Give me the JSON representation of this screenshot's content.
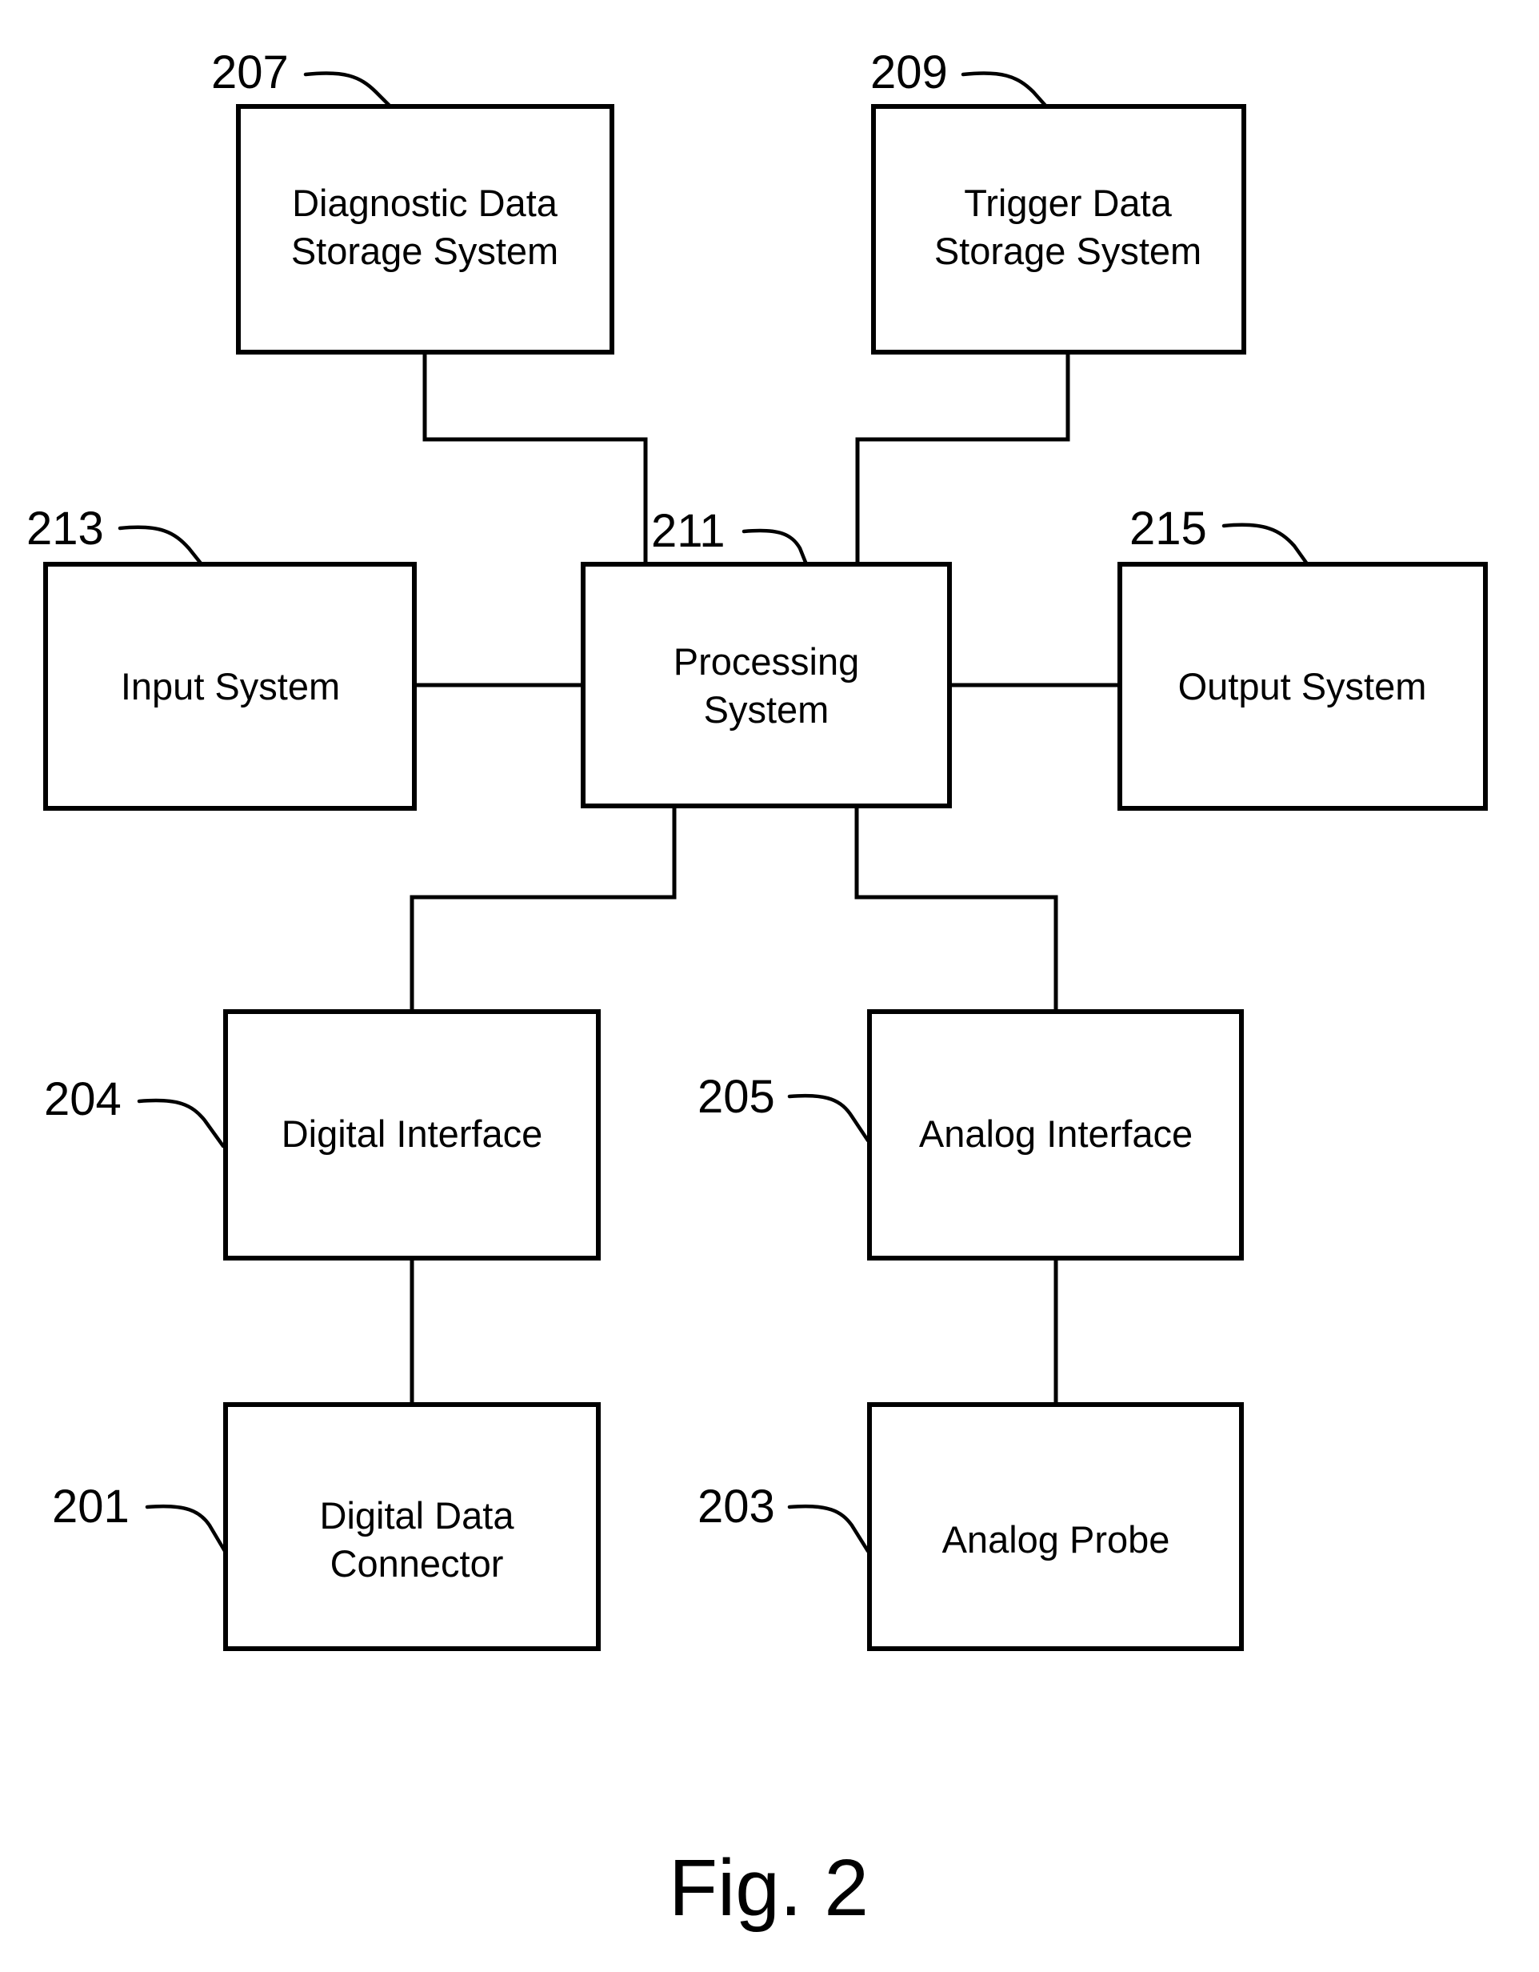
{
  "figure": {
    "caption": "Fig. 2",
    "nodes": [
      {
        "id": "207",
        "ref": "207",
        "lines": [
          "Diagnostic Data",
          "Storage System"
        ]
      },
      {
        "id": "209",
        "ref": "209",
        "lines": [
          "Trigger Data",
          "Storage System"
        ]
      },
      {
        "id": "213",
        "ref": "213",
        "lines": [
          "Input System"
        ]
      },
      {
        "id": "211",
        "ref": "211",
        "lines": [
          "Processing",
          "System"
        ]
      },
      {
        "id": "215",
        "ref": "215",
        "lines": [
          "Output System"
        ]
      },
      {
        "id": "204",
        "ref": "204",
        "lines": [
          "Digital Interface"
        ]
      },
      {
        "id": "205",
        "ref": "205",
        "lines": [
          "Analog Interface"
        ]
      },
      {
        "id": "201",
        "ref": "201",
        "lines": [
          "Digital Data",
          "Connector"
        ]
      },
      {
        "id": "203",
        "ref": "203",
        "lines": [
          "Analog Probe"
        ]
      }
    ],
    "edges": [
      {
        "from": "207",
        "to": "211"
      },
      {
        "from": "209",
        "to": "211"
      },
      {
        "from": "213",
        "to": "211"
      },
      {
        "from": "211",
        "to": "215"
      },
      {
        "from": "211",
        "to": "204"
      },
      {
        "from": "211",
        "to": "205"
      },
      {
        "from": "204",
        "to": "201"
      },
      {
        "from": "205",
        "to": "203"
      }
    ]
  }
}
